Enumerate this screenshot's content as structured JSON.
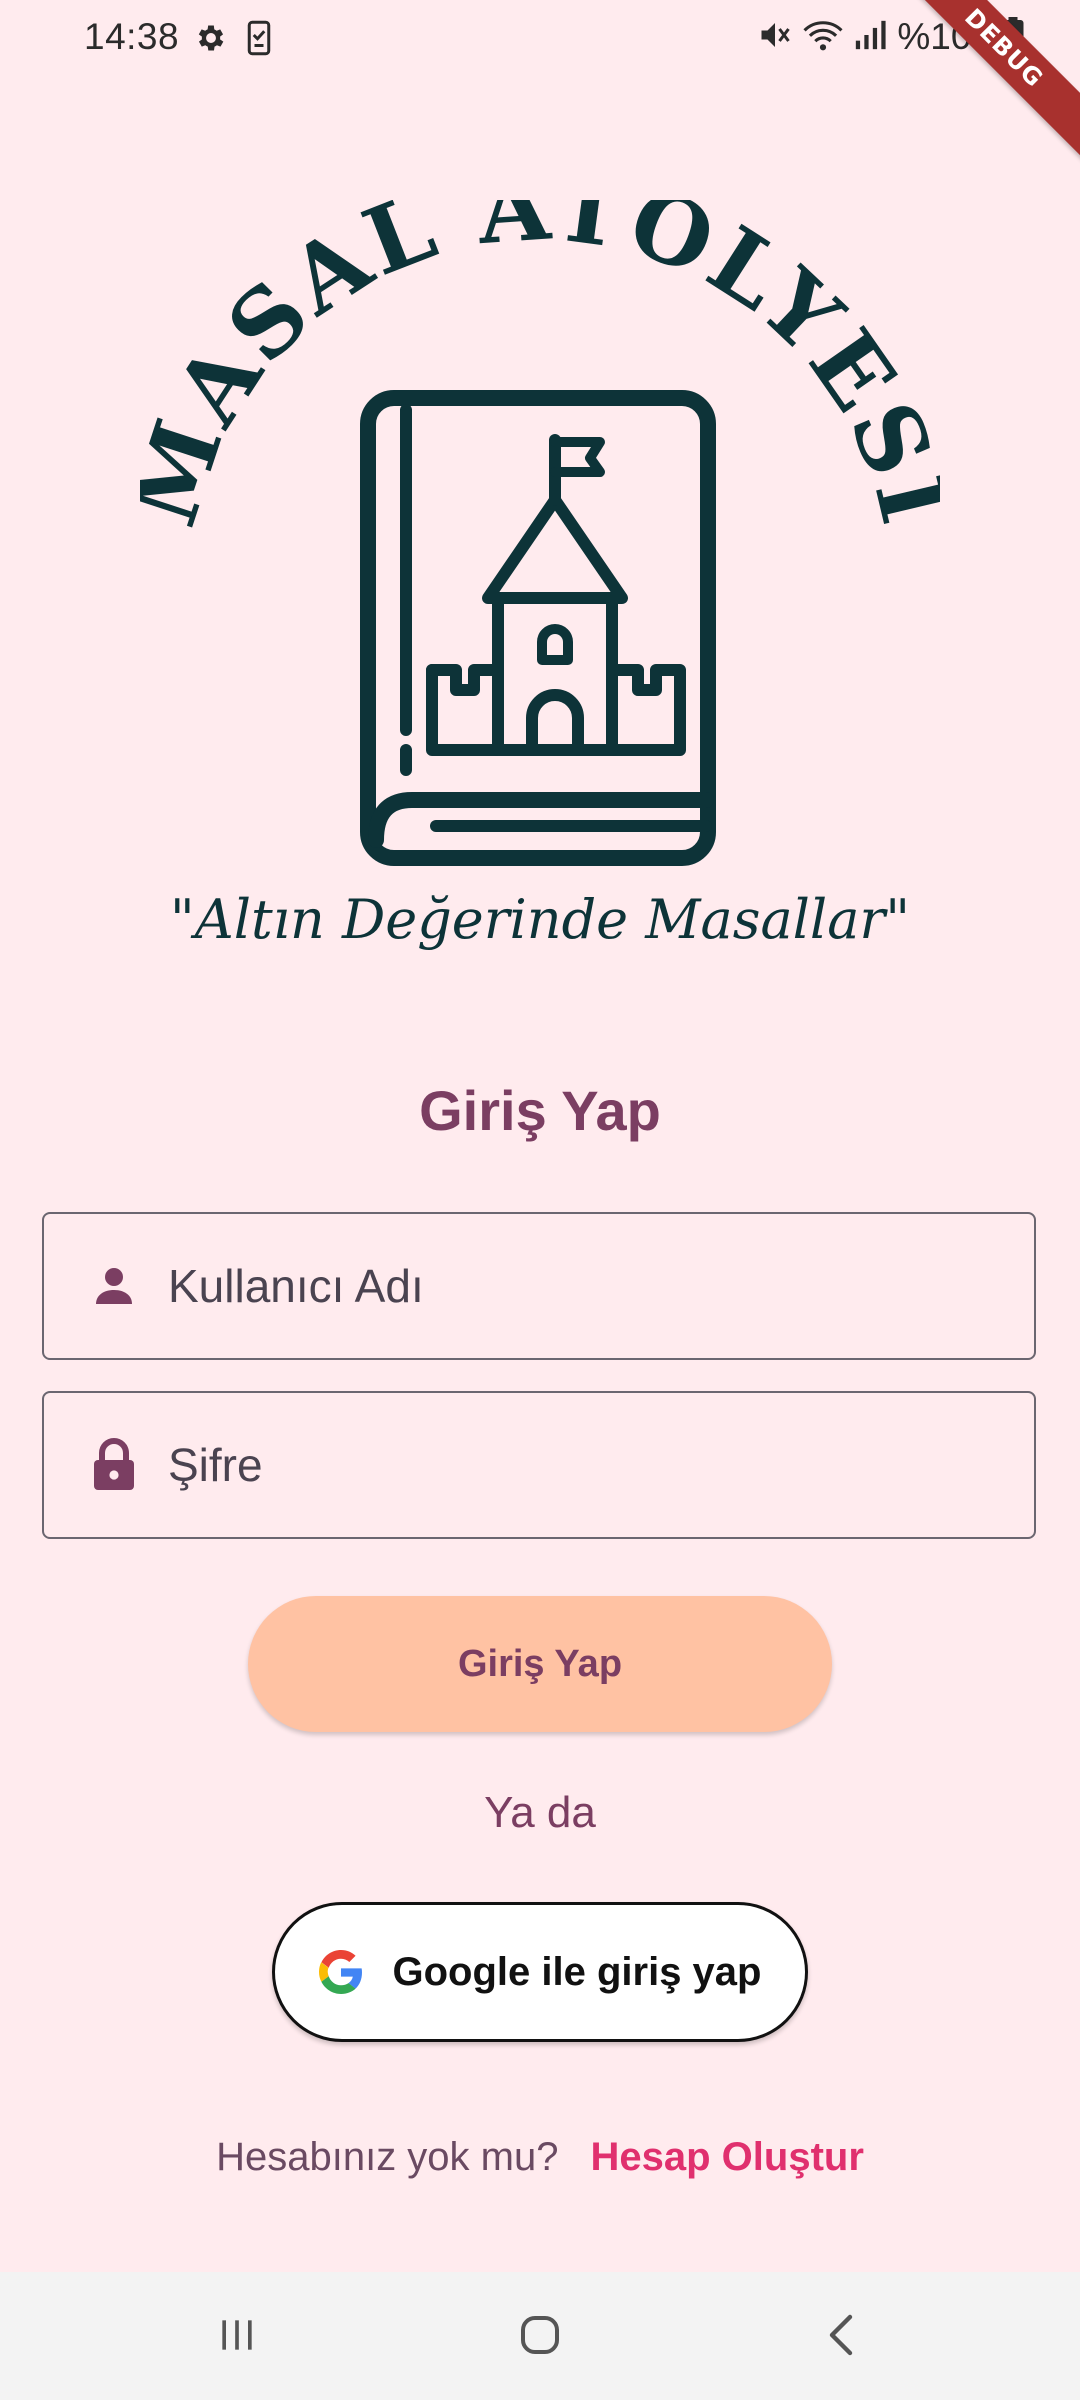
{
  "status_bar": {
    "time": "14:38",
    "battery_percent": "%100"
  },
  "debug_banner": "DEBUG",
  "logo": {
    "title": "MASAL ATÖLYESİ",
    "tagline": "\"Altın Değerinde Masallar\""
  },
  "login": {
    "title": "Giriş Yap",
    "username_placeholder": "Kullanıcı Adı",
    "password_placeholder": "Şifre",
    "submit_label": "Giriş Yap",
    "divider_text": "Ya da",
    "google_label": "Google ile giriş yap",
    "no_account_text": "Hesabınız yok mu?",
    "create_account_label": "Hesap Oluştur"
  },
  "colors": {
    "background": "#FFEBEE",
    "primary": "#7B3E62",
    "button_fill": "#FFC2A3",
    "link": "#E0306E",
    "logo_ink": "#0D3338"
  },
  "icons": {
    "status_left": [
      "settings-gear-icon",
      "phone-check-icon"
    ],
    "status_right": [
      "mute-icon",
      "wifi-icon",
      "signal-icon",
      "battery-icon"
    ],
    "username": "person-icon",
    "password": "lock-icon",
    "google": "google-g-icon",
    "nav": [
      "recents-icon",
      "home-icon",
      "back-icon"
    ]
  }
}
